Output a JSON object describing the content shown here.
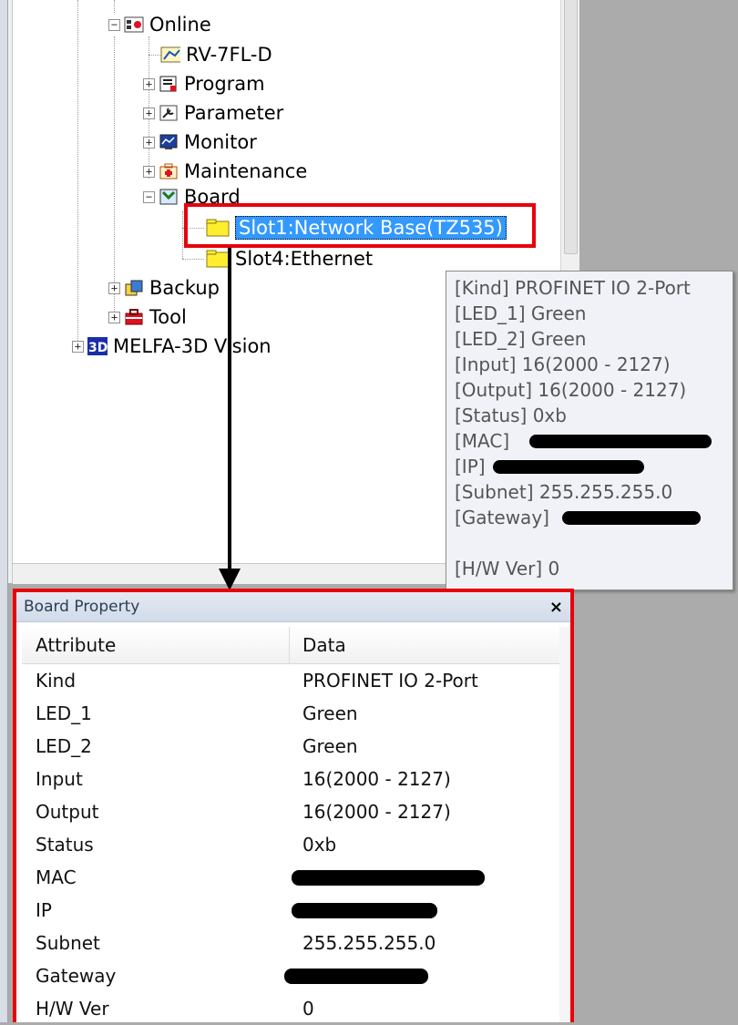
{
  "tree": {
    "items": [
      {
        "label": "Online",
        "icon": "online-icon",
        "expander": "−"
      },
      {
        "label": "RV-7FL-D",
        "icon": "robot-icon",
        "expander": ""
      },
      {
        "label": "Program",
        "icon": "program-icon",
        "expander": "+"
      },
      {
        "label": "Parameter",
        "icon": "parameter-icon",
        "expander": "+"
      },
      {
        "label": "Monitor",
        "icon": "monitor-icon",
        "expander": "+"
      },
      {
        "label": "Maintenance",
        "icon": "maintenance-icon",
        "expander": "+"
      },
      {
        "label": "Board",
        "icon": "board-icon",
        "expander": "−"
      },
      {
        "label": "Slot1:Network Base(TZ535)",
        "icon": "folder-icon",
        "expander": ""
      },
      {
        "label": "Slot4:Ethernet",
        "icon": "folder-icon",
        "expander": ""
      },
      {
        "label": "Backup",
        "icon": "backup-icon",
        "expander": "+"
      },
      {
        "label": "Tool",
        "icon": "tool-icon",
        "expander": "+"
      },
      {
        "label": "MELFA-3D Vision",
        "icon": "vision-3d-icon",
        "expander": "+"
      }
    ]
  },
  "tooltip": {
    "lines": [
      "[Kind] PROFINET IO 2-Port",
      "[LED_1] Green",
      "[LED_2] Green",
      "[Input] 16(2000 - 2127)",
      "[Output] 16(2000 - 2127)",
      "[Status] 0xb",
      "[MAC]",
      "[IP]",
      "[Subnet] 255.255.255.0",
      "[Gateway]",
      "",
      "[H/W Ver]   0"
    ]
  },
  "board_property": {
    "title": "Board Property",
    "close": "×",
    "header": {
      "attribute": "Attribute",
      "data": "Data"
    },
    "rows": [
      {
        "attribute": "Kind",
        "data": "PROFINET IO 2-Port"
      },
      {
        "attribute": "LED_1",
        "data": "Green"
      },
      {
        "attribute": "LED_2",
        "data": "Green"
      },
      {
        "attribute": "Input",
        "data": "16(2000 - 2127)"
      },
      {
        "attribute": "Output",
        "data": "16(2000 - 2127)"
      },
      {
        "attribute": "Status",
        "data": "0xb"
      },
      {
        "attribute": "MAC",
        "data": ""
      },
      {
        "attribute": "IP",
        "data": ""
      },
      {
        "attribute": "Subnet",
        "data": "255.255.255.0"
      },
      {
        "attribute": "Gateway",
        "data": ""
      },
      {
        "attribute": "H/W Ver",
        "data": "0"
      }
    ]
  },
  "colors": {
    "highlight": "#e8000b",
    "selection": "#3399ff"
  }
}
